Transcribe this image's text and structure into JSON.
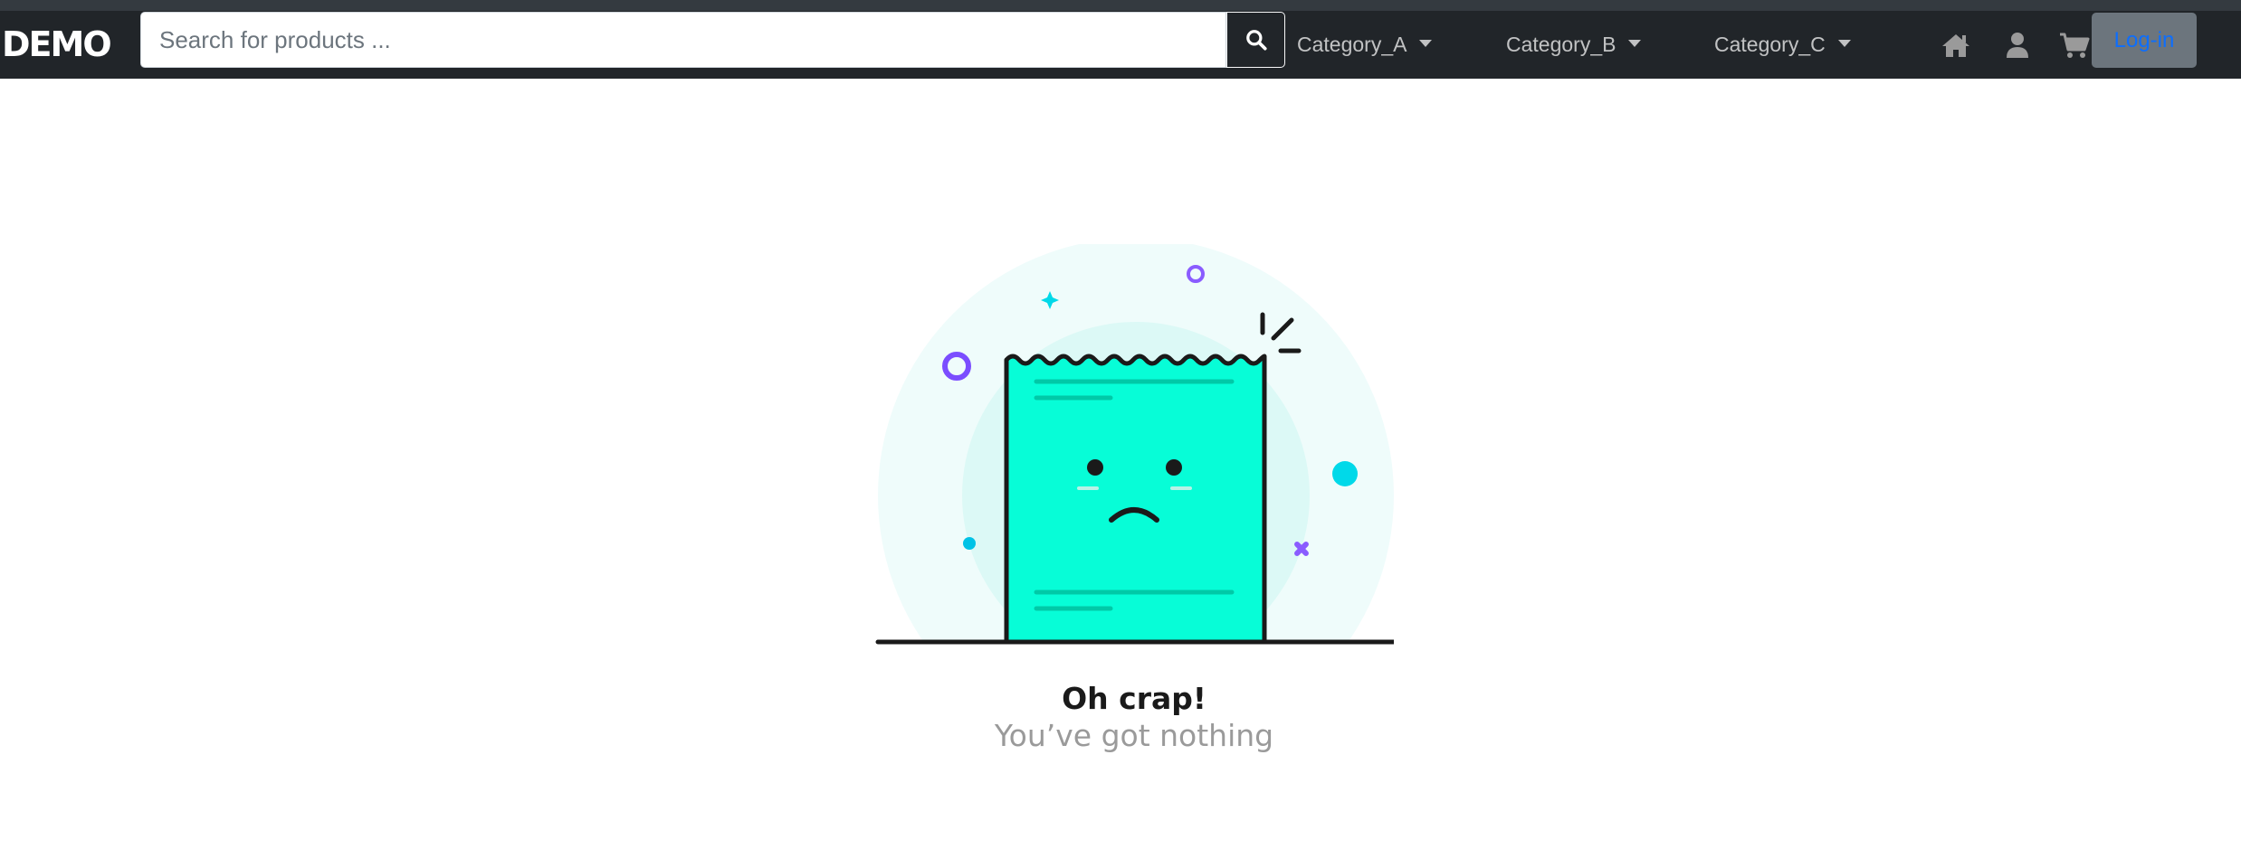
{
  "navbar": {
    "brand": "DEMO",
    "search": {
      "placeholder": "Search for products ...",
      "value": ""
    },
    "categories": [
      {
        "label": "Category_A"
      },
      {
        "label": "Category_B"
      },
      {
        "label": "Category_C"
      }
    ],
    "icons": [
      "search-icon",
      "home-icon",
      "user-icon",
      "cart-icon"
    ],
    "login_label": "Log-in"
  },
  "empty_state": {
    "title": "Oh crap!",
    "subtitle": "You’ve got nothing"
  },
  "colors": {
    "navbar_bg": "#212529",
    "accent_green": "#07FDD7",
    "purple": "#7B4DFF",
    "cyan": "#00D9E9",
    "login_bg": "#6c757d",
    "login_text": "#0d6efd"
  }
}
